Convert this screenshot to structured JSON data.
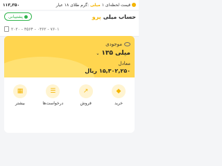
{
  "topbar": {
    "price": "۱۱۳,۳۵۰",
    "rate_prefix": "قیمت لحظه‌ای ۱",
    "rate_brand": "میلی",
    "rate_suffix": "گرم طلای ۱۸ عیار:"
  },
  "account": {
    "title": "حساب میلی",
    "brand": "پرو",
    "support_label": "پشتیبانی",
    "number": "۲۰۲۰ - ۳۵۶۴ - ۰۳۶۲ - ۷۶۰۱"
  },
  "balance": {
    "label": "موجودی",
    "value": "۱۳۵ میلی",
    "equiv_label": "معادل",
    "equiv_value": "۱۵,۳۰۲,۲۵۰",
    "equiv_unit": "ریال"
  },
  "actions": [
    {
      "label": "خرید",
      "icon": "gold-bag-icon"
    },
    {
      "label": "فروش",
      "icon": "sell-icon"
    },
    {
      "label": "درخواست‌ها",
      "icon": "requests-icon"
    },
    {
      "label": "بیشتر",
      "icon": "grid-icon"
    }
  ]
}
